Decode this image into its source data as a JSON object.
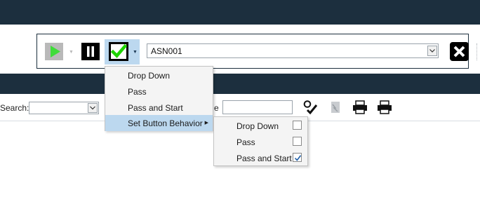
{
  "toolbar": {
    "document_value": "ASN001",
    "icons": [
      "play-icon",
      "pause-icon",
      "checkmark-icon",
      "close-icon"
    ]
  },
  "search": {
    "label": "Search:",
    "second_label_fragment": "e"
  },
  "menu": {
    "items": [
      {
        "label": "Drop Down"
      },
      {
        "label": "Pass"
      },
      {
        "label": "Pass and Start"
      },
      {
        "label": "Set Button Behavior"
      }
    ]
  },
  "submenu": {
    "items": [
      {
        "label": "Drop Down",
        "checked": false
      },
      {
        "label": "Pass",
        "checked": false
      },
      {
        "label": "Pass and Start",
        "checked": true
      }
    ]
  },
  "colors": {
    "header_bg": "#1c2f3e",
    "highlight": "#bcd8ef",
    "check_green": "#1ed400"
  }
}
